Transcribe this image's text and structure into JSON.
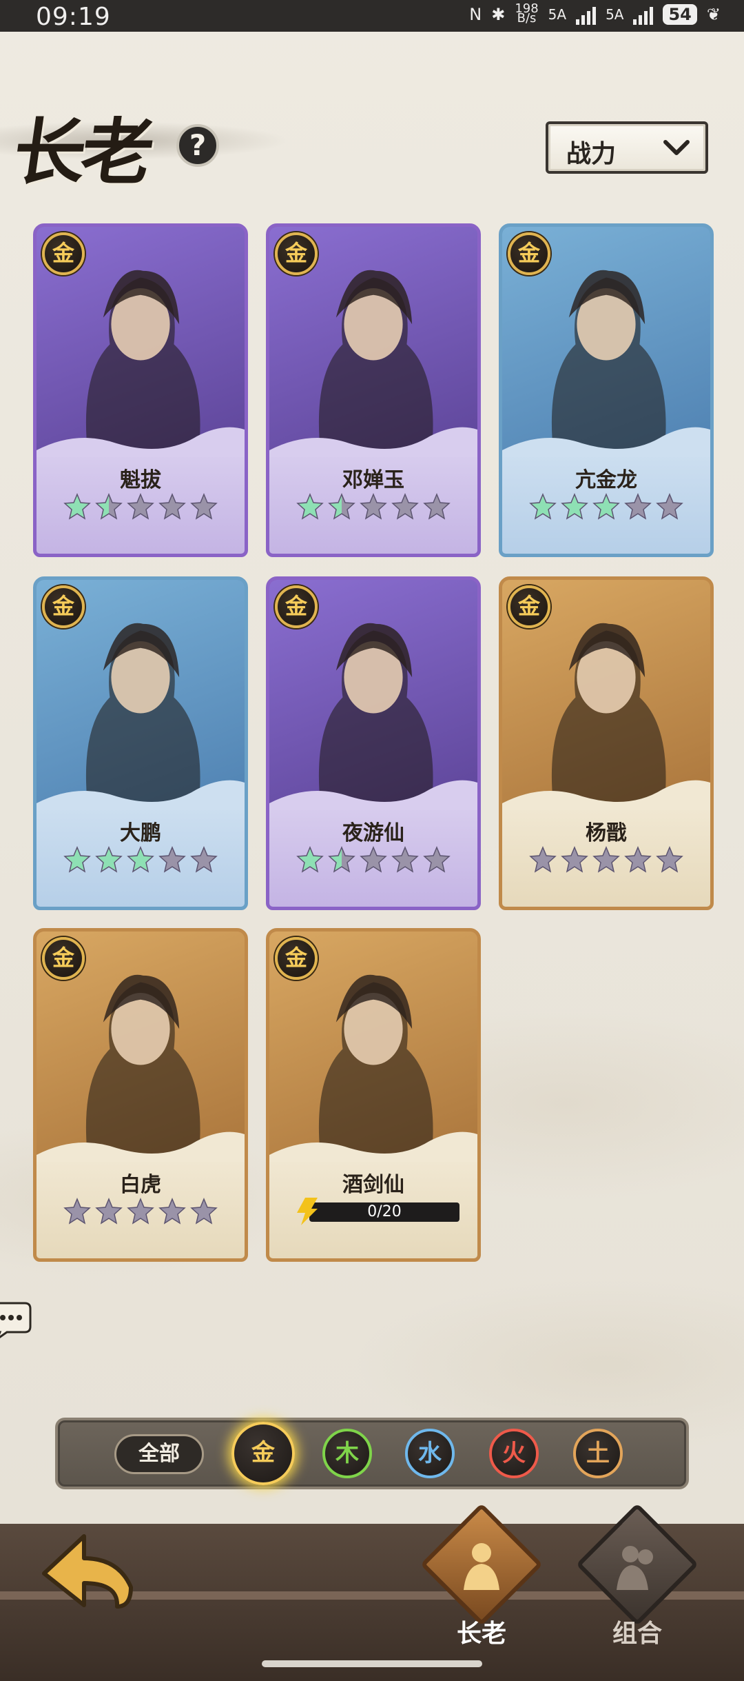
{
  "status_bar": {
    "time": "09:19",
    "nfc": "N",
    "bluetooth": "✱",
    "speed_top": "198",
    "speed_bottom": "B/s",
    "sim1": "5A",
    "sim2": "5A",
    "battery": "54"
  },
  "header": {
    "title": "长老",
    "help": "?",
    "sort_label": "战力"
  },
  "cards": [
    {
      "name": "魁拔",
      "element": "金",
      "rarity_color": "purple",
      "stars_filled": 1.5,
      "stars_total": 5
    },
    {
      "name": "邓婵玉",
      "element": "金",
      "rarity_color": "purple",
      "stars_filled": 1.5,
      "stars_total": 5
    },
    {
      "name": "亢金龙",
      "element": "金",
      "rarity_color": "blue",
      "stars_filled": 3,
      "stars_total": 5
    },
    {
      "name": "大鹏",
      "element": "金",
      "rarity_color": "blue",
      "stars_filled": 3,
      "stars_total": 5
    },
    {
      "name": "夜游仙",
      "element": "金",
      "rarity_color": "purple",
      "stars_filled": 1.5,
      "stars_total": 5
    },
    {
      "name": "杨戬",
      "element": "金",
      "rarity_color": "gold",
      "stars_filled": 0,
      "stars_total": 5
    },
    {
      "name": "白虎",
      "element": "金",
      "rarity_color": "gold",
      "stars_filled": 0,
      "stars_total": 5
    },
    {
      "name": "酒剑仙",
      "element": "金",
      "rarity_color": "gold",
      "fragments": "0/20"
    }
  ],
  "filter": {
    "all": "全部",
    "elements": [
      {
        "label": "金",
        "color": "#f6cc5a",
        "active": true
      },
      {
        "label": "木",
        "color": "#7fd44a",
        "active": false
      },
      {
        "label": "水",
        "color": "#6fb8ec",
        "active": false
      },
      {
        "label": "火",
        "color": "#ef5a4a",
        "active": false
      },
      {
        "label": "土",
        "color": "#e3a55a",
        "active": false
      }
    ]
  },
  "bottom_nav": {
    "tab_elders": "长老",
    "tab_combo": "组合"
  },
  "colors": {
    "star_filled": "#8ee0b4",
    "star_empty": "#9a93a8"
  }
}
